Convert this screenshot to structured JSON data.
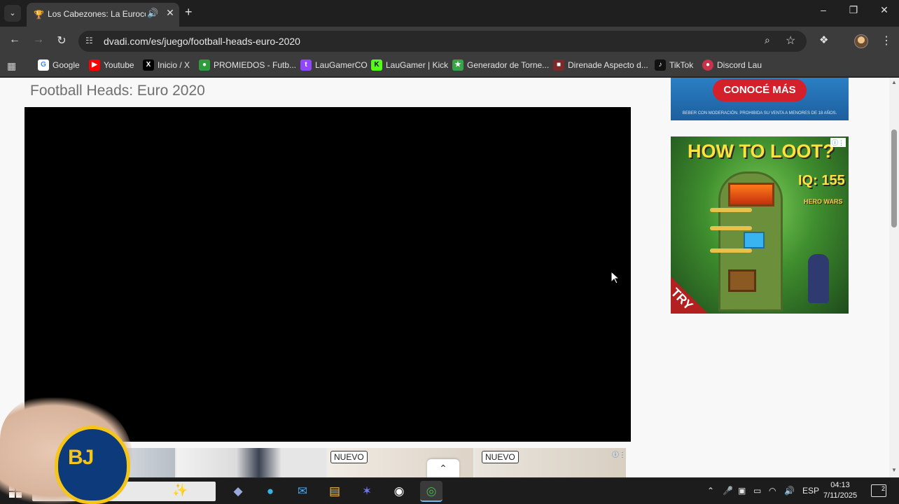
{
  "browser": {
    "tab": {
      "title": "Los Cabezones: La Eurocopa",
      "favicon_icon": "trophy-icon"
    },
    "url": "dvadi.com/es/juego/football-heads-euro-2020",
    "bookmarks": [
      {
        "label": "Google",
        "icon": "google-icon",
        "color": "#4285f4"
      },
      {
        "label": "Youtube",
        "icon": "youtube-icon",
        "color": "#ff0000"
      },
      {
        "label": "Inicio / X",
        "icon": "x-icon",
        "color": "#000000"
      },
      {
        "label": "PROMIEDOS - Futb...",
        "icon": "promiedos-icon",
        "color": "#2e9b3f"
      },
      {
        "label": "LauGamerCO",
        "icon": "twitch-icon",
        "color": "#9146ff"
      },
      {
        "label": "LauGamer | Kick",
        "icon": "kick-icon",
        "color": "#53fc18"
      },
      {
        "label": "Generador de Torne...",
        "icon": "trophy-icon",
        "color": "#3aa34a"
      },
      {
        "label": "Direnade Aspecto d...",
        "icon": "game-icon",
        "color": "#7a2a2a"
      },
      {
        "label": "TikTok",
        "icon": "tiktok-icon",
        "color": "#111111"
      },
      {
        "label": "Discord Lau",
        "icon": "discord-icon",
        "color": "#c8324a"
      }
    ]
  },
  "page": {
    "title": "Football Heads: Euro 2020",
    "ad_top": {
      "cta": "CONOCÉ MÁS",
      "fine_print": "BEBER CON MODERACIÓN. PROHIBIDA SU VENTA A MENORES DE 18 AÑOS."
    },
    "ad_hero": {
      "headline": "HOW TO LOOT?",
      "iq": "IQ: 155",
      "brand": "HERO WARS",
      "try": "TRY"
    },
    "bottom_ad": {
      "badges": [
        "NUEVO",
        "NUEVO"
      ]
    }
  },
  "overlay": {
    "badge_text": "BJ"
  },
  "taskbar": {
    "language": "ESP",
    "time": "04:13",
    "date": "7/11/2025",
    "notifications": "2"
  },
  "colors": {
    "page_bg": "#f8f8f8",
    "canvas": "#000000",
    "taskbar": "#1c1c1c"
  }
}
